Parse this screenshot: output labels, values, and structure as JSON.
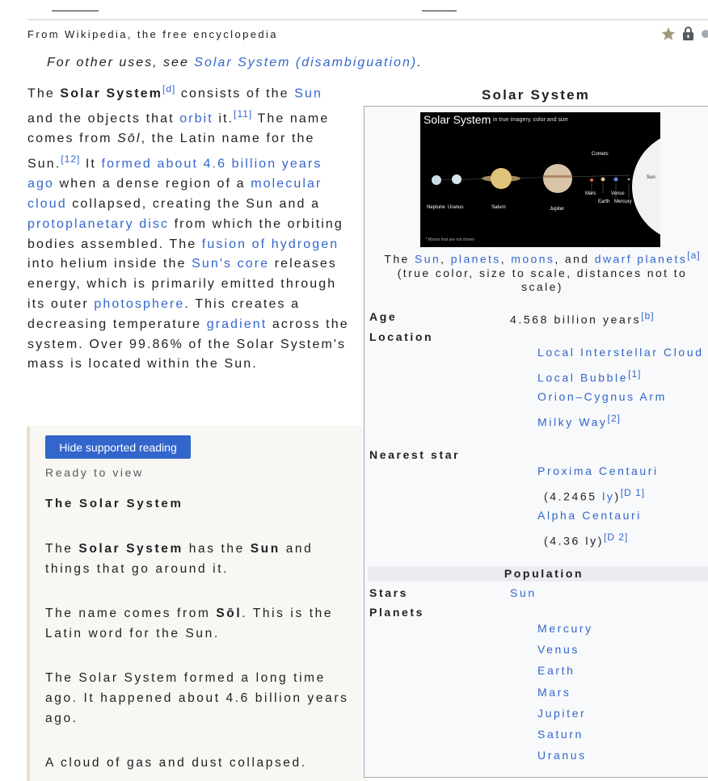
{
  "page": {
    "tagline": "From Wikipedia, the free encyclopedia",
    "hatnote_prefix": "For other uses, see ",
    "hatnote_link": "Solar System (disambiguation)",
    "hatnote_suffix": ".",
    "indicators": [
      "star-icon",
      "lock-icon",
      "audio-icon"
    ]
  },
  "lead": {
    "t1": "The ",
    "bold": "Solar System",
    "ref_d": "[d]",
    "t2": " consists of the ",
    "sun": "Sun",
    "t3": " and the objects that ",
    "orbit": "orbit",
    "t4": " it.",
    "ref_11": "[11]",
    "t5": " The name comes from ",
    "sol": "Sōl",
    "t6": ", the Latin name for the Sun.",
    "ref_12": "[12]",
    "t7": " It ",
    "formed": "formed about 4.6 billion years ago",
    "t8": " when a dense region of a ",
    "molecular": "molecular cloud",
    "t9": " collapsed, creating the Sun and a ",
    "protoplanetary": "protoplanetary disc",
    "t10": " from which the orbiting bodies assembled. The ",
    "fusion": "fusion of hydrogen",
    "t11": " into helium inside the ",
    "core": "Sun's core",
    "t12": " releases energy, which is primarily emitted through its outer ",
    "photosphere": "photosphere",
    "t13": ". This creates a decreasing temperature ",
    "gradient": "gradient",
    "t14": " across the system. Over 99.86% of the Solar System's mass is located within the Sun."
  },
  "reading": {
    "button": "Hide supported reading",
    "status": "Ready to view",
    "title": "The Solar System",
    "p1_a": "The ",
    "p1_b": "Solar System",
    "p1_c": " has the ",
    "p1_d": "Sun",
    "p1_e": " and things that go around it.",
    "p2_a": "The name comes from ",
    "p2_b": "Sōl",
    "p2_c": ". This is the Latin word for the Sun.",
    "p3": "The Solar System formed a long time ago. It happened about 4.6 billion years ago.",
    "p4": "A cloud of gas and dust collapsed."
  },
  "infobox": {
    "caption": "Solar System",
    "image": {
      "title": "Solar System",
      "subtitle": "in true imagery, color and size",
      "footnote": "* Moons that are not shown",
      "labels": [
        "Neptune",
        "Uranus",
        "Saturn",
        "Jupiter",
        "Mars",
        "Earth",
        "Venus",
        "Mercury",
        "Sun",
        "Comets"
      ]
    },
    "img_caption_a": "The ",
    "img_caption_sun": "Sun",
    "img_caption_b": ", ",
    "img_caption_planets": "planets",
    "img_caption_c": ", ",
    "img_caption_moons": "moons",
    "img_caption_d": ", and ",
    "img_caption_dwarf": "dwarf planets",
    "img_caption_ref": "[a]",
    "img_caption_e": "(true color, size to scale, distances not to scale)",
    "age_label": "Age",
    "age_value": "4.568 billion years",
    "age_ref": "[b]",
    "location_label": "Location",
    "locations": [
      "Local Interstellar Cloud",
      "Local Bubble",
      "Orion–Cygnus Arm",
      "Milky Way"
    ],
    "loc_ref_1": "[1]",
    "loc_ref_2": "[2]",
    "nearest_label": "Nearest star",
    "nearest_1": "Proxima Centauri",
    "nearest_1_dist": "(4.2465 ",
    "nearest_1_unit": "ly",
    "nearest_1_close": ")",
    "nearest_1_ref": "[D 1]",
    "nearest_2": "Alpha Centauri",
    "nearest_2_dist": "(4.36 ly)",
    "nearest_2_ref": "[D 2]",
    "population_header": "Population",
    "stars_label": "Stars",
    "stars_value": "Sun",
    "planets_label": "Planets",
    "planets": [
      "Mercury",
      "Venus",
      "Earth",
      "Mars",
      "Jupiter",
      "Saturn",
      "Uranus"
    ]
  }
}
